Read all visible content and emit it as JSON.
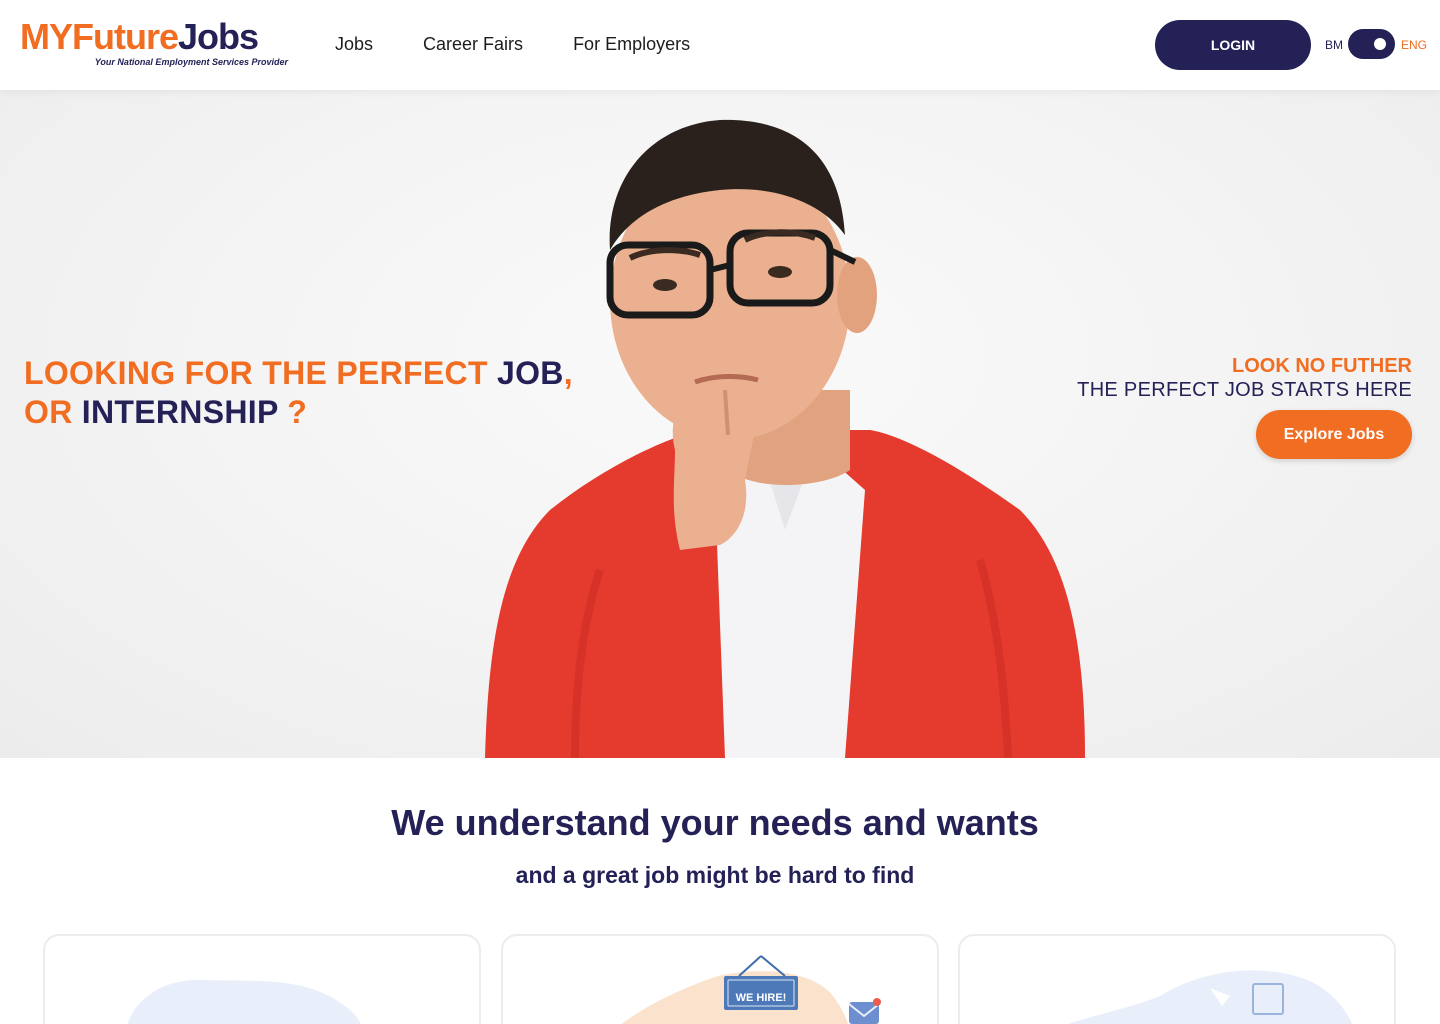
{
  "header": {
    "logo": {
      "my": "MY",
      "future": "Future",
      "jobs": "Jobs",
      "tagline": "Your National Employment Services Provider"
    },
    "nav": [
      "Jobs",
      "Career Fairs",
      "For Employers"
    ],
    "login_label": "LOGIN",
    "lang": {
      "bm": "BM",
      "eng": "ENG",
      "selected": "ENG"
    }
  },
  "hero": {
    "heading": {
      "part1": "LOOKING FOR THE PERFECT ",
      "job": "JOB",
      "comma": ",",
      "or": "OR ",
      "internship": "INTERNSHIP",
      "question": " ?"
    },
    "right": {
      "line1": "LOOK NO FUTHER",
      "line2": "THE PERFECT JOB STARTS HERE"
    },
    "cta_label": "Explore Jobs"
  },
  "section": {
    "title": "We understand your needs and wants",
    "subtitle": "and a great job might be hard to find"
  },
  "cards": [
    {
      "sign": ""
    },
    {
      "sign": "WE HIRE!"
    },
    {
      "sign": ""
    }
  ],
  "colors": {
    "brand_orange": "#f06d22",
    "brand_navy": "#232156",
    "cape_red": "#e53a2e"
  }
}
